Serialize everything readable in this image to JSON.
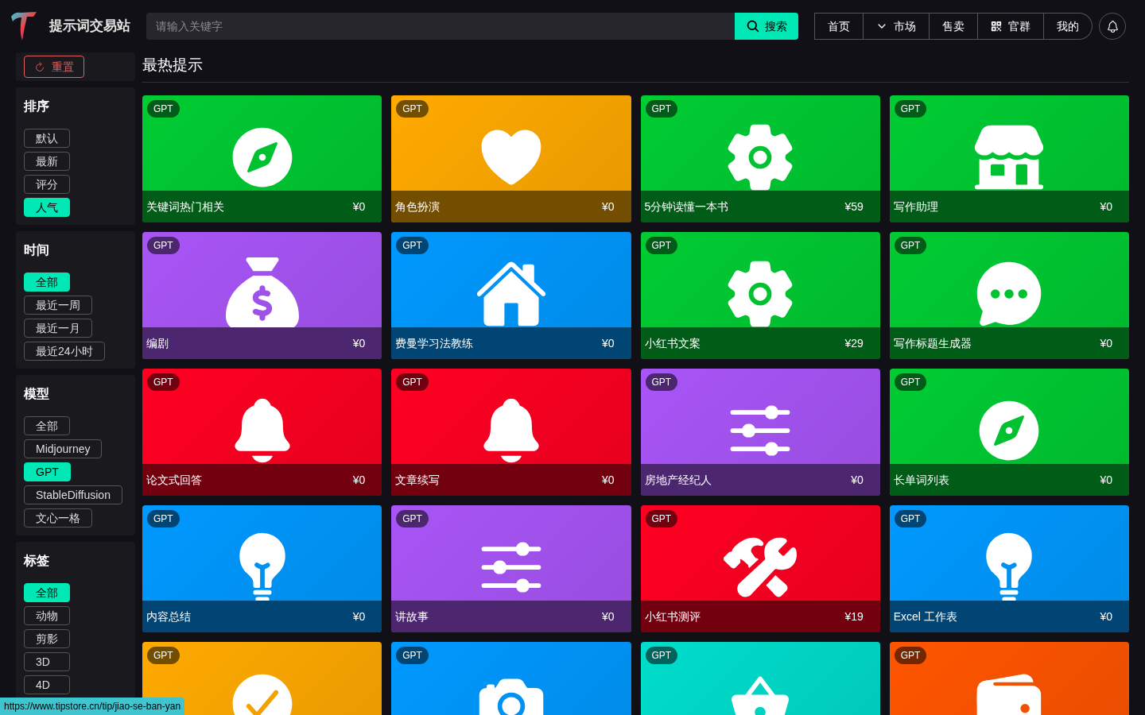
{
  "header": {
    "site_name": "提示词交易站",
    "search": {
      "placeholder": "请输入关键字",
      "button": "搜索"
    },
    "nav": [
      {
        "label": "首页",
        "kind": "plain"
      },
      {
        "label": "市场",
        "kind": "dropdown"
      },
      {
        "label": "售卖",
        "kind": "plain"
      },
      {
        "label": "官群",
        "kind": "qrcode"
      },
      {
        "label": "我的",
        "kind": "plain"
      }
    ]
  },
  "sidebar": {
    "reset": "重置",
    "groups": [
      {
        "title": "排序",
        "options": [
          {
            "label": "默认",
            "selected": false
          },
          {
            "label": "最新",
            "selected": false
          },
          {
            "label": "评分",
            "selected": false
          },
          {
            "label": "人气",
            "selected": true
          }
        ]
      },
      {
        "title": "时间",
        "options": [
          {
            "label": "全部",
            "selected": true
          },
          {
            "label": "最近一周",
            "selected": false
          },
          {
            "label": "最近一月",
            "selected": false
          },
          {
            "label": "最近24小时",
            "selected": false
          }
        ]
      },
      {
        "title": "模型",
        "options": [
          {
            "label": "全部",
            "selected": false
          },
          {
            "label": "Midjourney",
            "selected": false
          },
          {
            "label": "GPT",
            "selected": true
          },
          {
            "label": "StableDiffusion",
            "selected": false
          },
          {
            "label": "文心一格",
            "selected": false
          }
        ]
      },
      {
        "title": "标签",
        "options": [
          {
            "label": "全部",
            "selected": true
          },
          {
            "label": "动物",
            "selected": false
          },
          {
            "label": "剪影",
            "selected": false
          },
          {
            "label": "3D",
            "selected": false
          },
          {
            "label": "4D",
            "selected": false
          }
        ]
      }
    ]
  },
  "main": {
    "title": "最热提示",
    "cards": [
      {
        "badge": "GPT",
        "title": "关键词热门相关",
        "price": "¥0",
        "kind": "compass",
        "color": "#00cc33"
      },
      {
        "badge": "GPT",
        "title": "角色扮演",
        "price": "¥0",
        "kind": "heart",
        "color": "#ffaa00"
      },
      {
        "badge": "GPT",
        "title": "5分钟读懂一本书",
        "price": "¥59",
        "kind": "gear",
        "color": "#00cc33"
      },
      {
        "badge": "GPT",
        "title": "写作助理",
        "price": "¥0",
        "kind": "store",
        "color": "#00cc33"
      },
      {
        "badge": "GPT",
        "title": "编剧",
        "price": "¥0",
        "kind": "moneybag",
        "color": "#a855f7"
      },
      {
        "badge": "GPT",
        "title": "费曼学习法教练",
        "price": "¥0",
        "kind": "house",
        "color": "#0099ff"
      },
      {
        "badge": "GPT",
        "title": "小红书文案",
        "price": "¥29",
        "kind": "gear",
        "color": "#00cc33"
      },
      {
        "badge": "GPT",
        "title": "写作标题生成器",
        "price": "¥0",
        "kind": "chat",
        "color": "#00cc33"
      },
      {
        "badge": "GPT",
        "title": "论文式回答",
        "price": "¥0",
        "kind": "bell",
        "color": "#ff0022"
      },
      {
        "badge": "GPT",
        "title": "文章续写",
        "price": "¥0",
        "kind": "bell",
        "color": "#ff0022"
      },
      {
        "badge": "GPT",
        "title": "房地产经纪人",
        "price": "¥0",
        "kind": "sliders",
        "color": "#a855f7"
      },
      {
        "badge": "GPT",
        "title": "长单词列表",
        "price": "¥0",
        "kind": "compass",
        "color": "#00cc33"
      },
      {
        "badge": "GPT",
        "title": "内容总结",
        "price": "¥0",
        "kind": "bulb",
        "color": "#0099ff"
      },
      {
        "badge": "GPT",
        "title": "讲故事",
        "price": "¥0",
        "kind": "sliders",
        "color": "#a855f7"
      },
      {
        "badge": "GPT",
        "title": "小红书测评",
        "price": "¥19",
        "kind": "wrench",
        "color": "#ff0022"
      },
      {
        "badge": "GPT",
        "title": "Excel 工作表",
        "price": "¥0",
        "kind": "bulb",
        "color": "#0099ff"
      },
      {
        "badge": "GPT",
        "kind": "check",
        "color": "#ffaa00"
      },
      {
        "badge": "GPT",
        "kind": "camera",
        "color": "#0099ff"
      },
      {
        "badge": "GPT",
        "kind": "basket",
        "color": "#00ddcc"
      },
      {
        "badge": "GPT",
        "kind": "wallet",
        "color": "#ff5500"
      }
    ]
  },
  "status_url": "https://www.tipstore.cn/tip/jiao-se-ban-yan"
}
